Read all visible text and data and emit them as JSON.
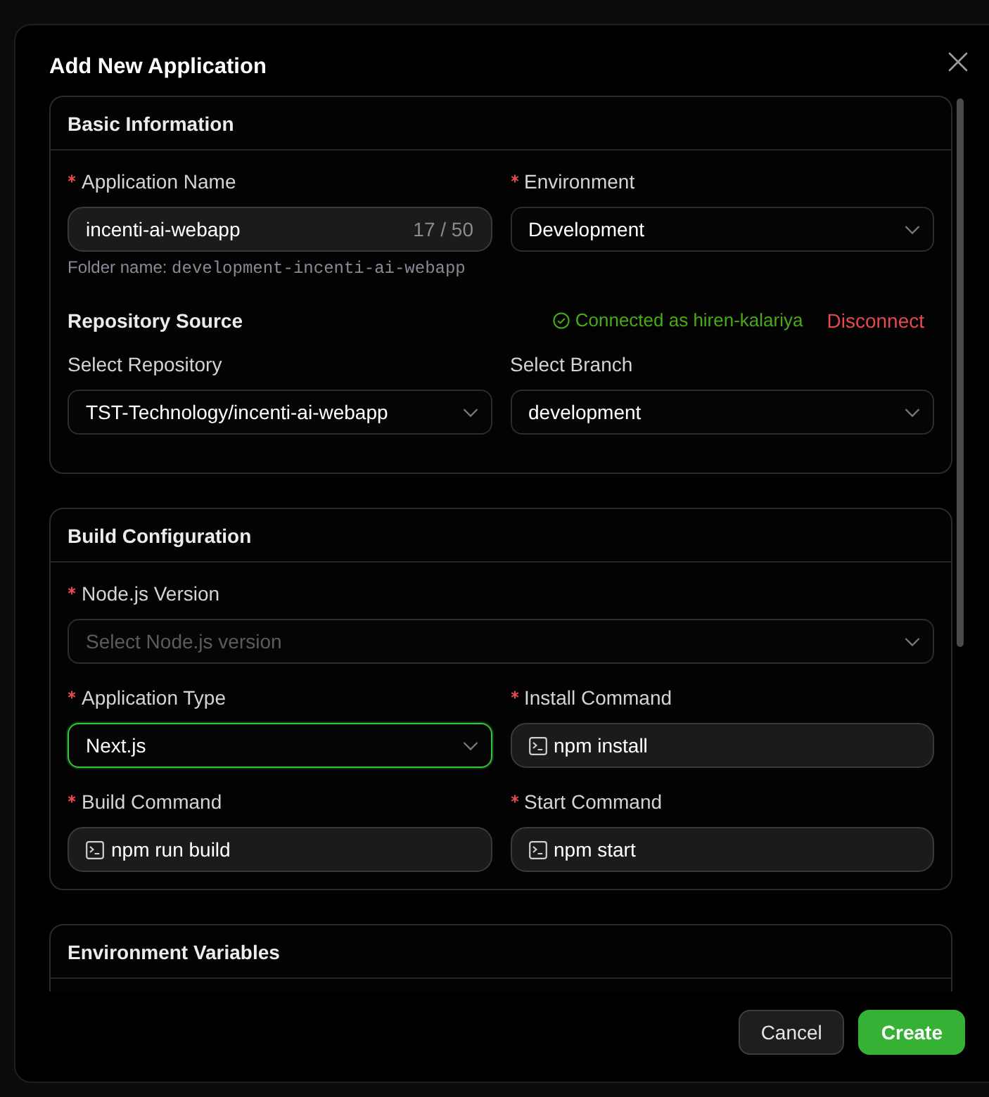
{
  "dialog": {
    "title": "Add New Application"
  },
  "sections": [
    {
      "title": "Basic Information",
      "blocks": [
        {
          "kind": "fields",
          "fields": [
            {
              "kind": "text",
              "label": "Application Name",
              "required": true,
              "value": "incenti-ai-webapp",
              "counter": "17 / 50",
              "hint": "Folder name:",
              "hint_code": "development-incenti-ai-webapp",
              "focused": false
            },
            {
              "kind": "select",
              "label": "Environment",
              "required": true,
              "value": "Development",
              "focused": false
            }
          ]
        },
        {
          "kind": "source",
          "title": "Repository Source",
          "status": "Connected as hiren-kalariya",
          "connected": true,
          "action": "Disconnect"
        },
        {
          "kind": "fields",
          "fields": [
            {
              "kind": "select",
              "label": "Select Repository",
              "required": false,
              "value": "TST-Technology/incenti-ai-webapp",
              "focused": false
            },
            {
              "kind": "select",
              "label": "Select Branch",
              "required": false,
              "value": "development",
              "focused": false
            }
          ]
        }
      ]
    },
    {
      "title": "Build Configuration",
      "blocks": [
        {
          "kind": "fields",
          "fields": [
            {
              "kind": "select",
              "label": "Node.js Version",
              "required": true,
              "placeholder": "Select Node.js version",
              "focused": false
            }
          ]
        },
        {
          "kind": "fields",
          "fields": [
            {
              "kind": "select",
              "label": "Application Type",
              "required": true,
              "value": "Next.js",
              "focused": true
            },
            {
              "kind": "command",
              "label": "Install Command",
              "required": true,
              "value": "npm install",
              "focused": false
            }
          ]
        },
        {
          "kind": "fields",
          "fields": [
            {
              "kind": "command",
              "label": "Build Command",
              "required": true,
              "value": "npm run build",
              "focused": false
            },
            {
              "kind": "command",
              "label": "Start Command",
              "required": true,
              "value": "npm start",
              "focused": false
            }
          ]
        }
      ]
    },
    {
      "title": "Environment Variables"
    }
  ],
  "buttons": [
    {
      "label": "Cancel",
      "kind": "secondary"
    },
    {
      "label": "Create",
      "kind": "primary"
    }
  ]
}
